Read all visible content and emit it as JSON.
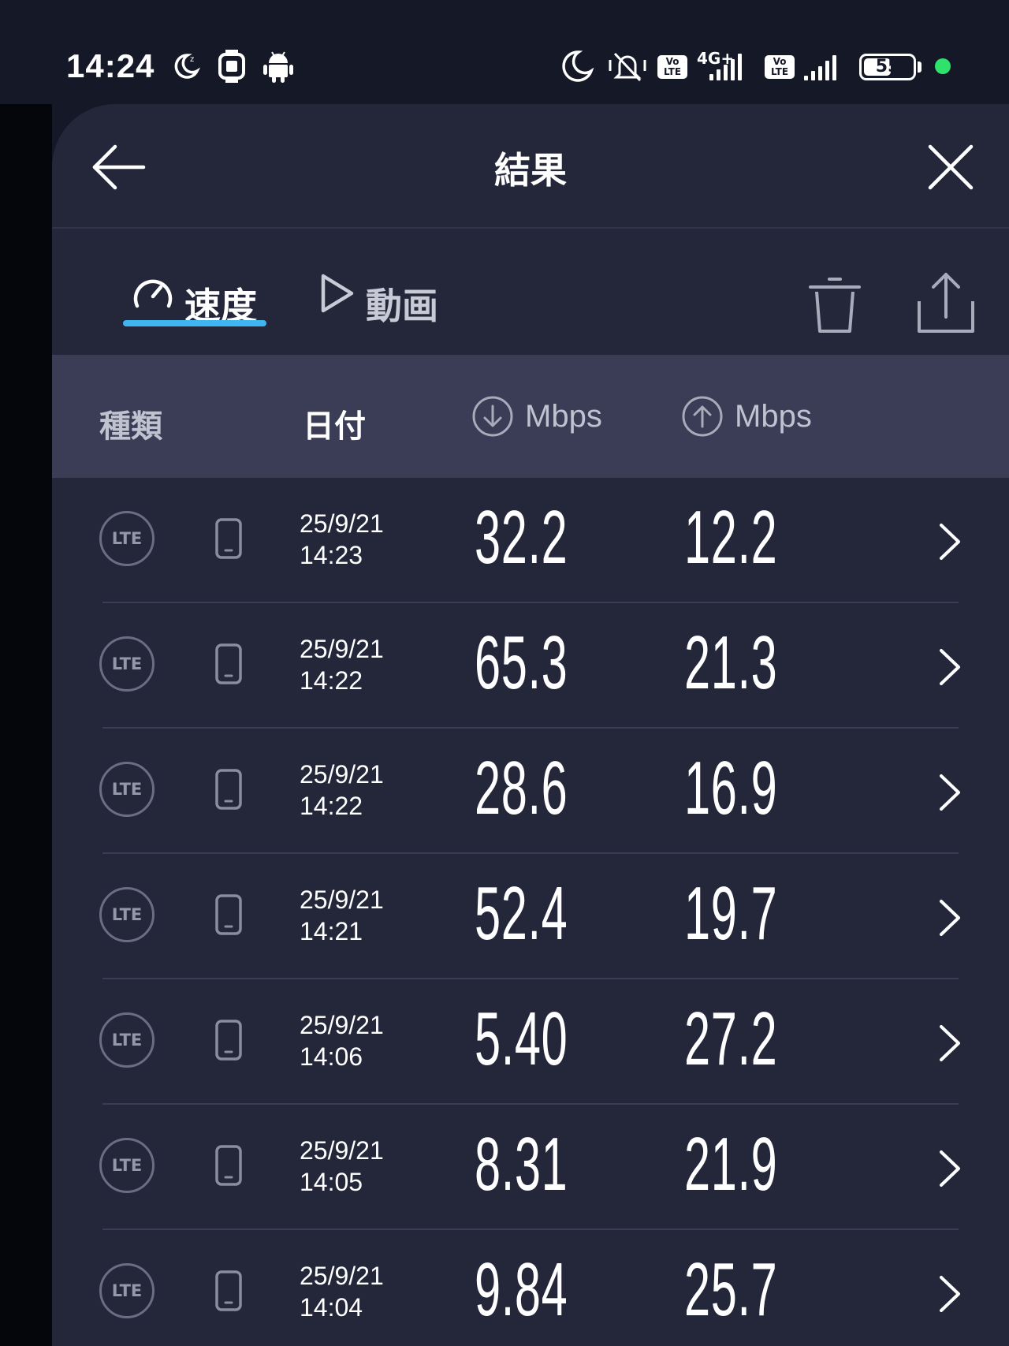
{
  "status_bar": {
    "time": "14:24",
    "network_type": "4G+",
    "volte_label_1": "Vo LTE",
    "volte_label_2": "Vo LTE",
    "battery_percent": "55",
    "icons": [
      "moon-sleep-icon",
      "watch-icon",
      "android-icon",
      "do-not-disturb-icon",
      "vibrate-mute-icon",
      "signal-icon",
      "battery-icon"
    ]
  },
  "header": {
    "title": "結果"
  },
  "tabs": [
    {
      "label": "速度",
      "icon": "speedometer-icon",
      "active": true
    },
    {
      "label": "動画",
      "icon": "play-icon",
      "active": false
    }
  ],
  "columns": {
    "type": "種類",
    "date": "日付",
    "download_unit": "Mbps",
    "upload_unit": "Mbps"
  },
  "rows": [
    {
      "type": "LTE",
      "date": "25/9/21",
      "time": "14:23",
      "download": "32.2",
      "upload": "12.2"
    },
    {
      "type": "LTE",
      "date": "25/9/21",
      "time": "14:22",
      "download": "65.3",
      "upload": "21.3"
    },
    {
      "type": "LTE",
      "date": "25/9/21",
      "time": "14:22",
      "download": "28.6",
      "upload": "16.9"
    },
    {
      "type": "LTE",
      "date": "25/9/21",
      "time": "14:21",
      "download": "52.4",
      "upload": "19.7"
    },
    {
      "type": "LTE",
      "date": "25/9/21",
      "time": "14:06",
      "download": "5.40",
      "upload": "27.2"
    },
    {
      "type": "LTE",
      "date": "25/9/21",
      "time": "14:05",
      "download": "8.31",
      "upload": "21.9"
    },
    {
      "type": "LTE",
      "date": "25/9/21",
      "time": "14:04",
      "download": "9.84",
      "upload": "25.7"
    }
  ],
  "colors": {
    "background": "#151827",
    "panel": "#24263a",
    "column_header": "#3a3d55",
    "accent": "#3fb6f2",
    "status_dot": "#2ee26b"
  }
}
